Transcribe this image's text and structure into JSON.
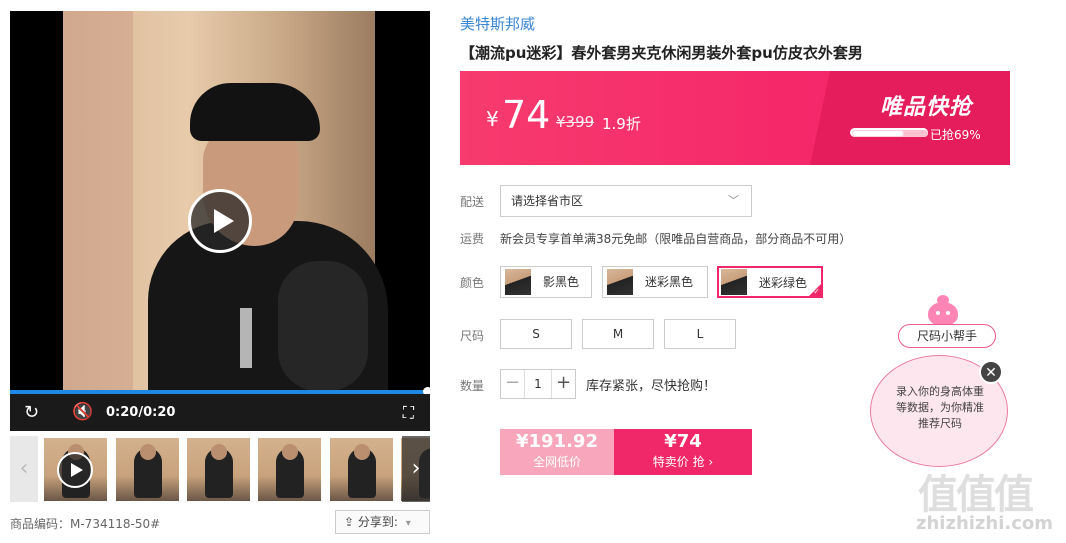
{
  "product": {
    "brand": "美特斯邦威",
    "title": "【潮流pu迷彩】春外套男夹克休闲男装外套pu仿皮衣外套男",
    "sku_label": "商品编码：M-734118-50#"
  },
  "player": {
    "time": "0:20/0:20",
    "progress": 1.0,
    "icons": [
      "replay-icon",
      "mute-icon",
      "fullscreen-icon",
      "play-icon"
    ]
  },
  "share": {
    "label": "分享到:"
  },
  "price": {
    "currency": "¥",
    "current": "74",
    "original": "¥399",
    "discount": "1.9折",
    "flash_label": "唯品快抢",
    "sold_text": "已抢69%",
    "sold_fraction": 0.69
  },
  "labels": {
    "delivery": "配送",
    "shipping": "运费",
    "color": "颜色",
    "size": "尺码",
    "quantity": "数量"
  },
  "delivery": {
    "region_placeholder": "请选择省市区"
  },
  "shipping_note": "新会员专享首单满38元免邮（限唯品自营商品，部分商品不可用）",
  "colors": [
    {
      "label": "影黑色",
      "selected": false
    },
    {
      "label": "迷彩黑色",
      "selected": false
    },
    {
      "label": "迷彩绿色",
      "selected": true
    }
  ],
  "sizes": [
    "S",
    "M",
    "L"
  ],
  "quantity": {
    "value": "1",
    "minus": "−",
    "plus": "+",
    "note": "库存紧张，尽快抢购！"
  },
  "buy": {
    "left_price": "¥191.92",
    "left_sub": "全网低价",
    "right_price": "¥74",
    "right_sub": "特卖价 抢 ›"
  },
  "size_helper": {
    "tag": "尺码小帮手",
    "bubble": "录入你的身高体重等数据，为你精准推荐尺码"
  },
  "watermark": {
    "logo": "值值值",
    "url": "zhizhizhi.com"
  },
  "colors_theme": {
    "accent": "#f0286a",
    "brand_blue": "#3a86d6"
  }
}
